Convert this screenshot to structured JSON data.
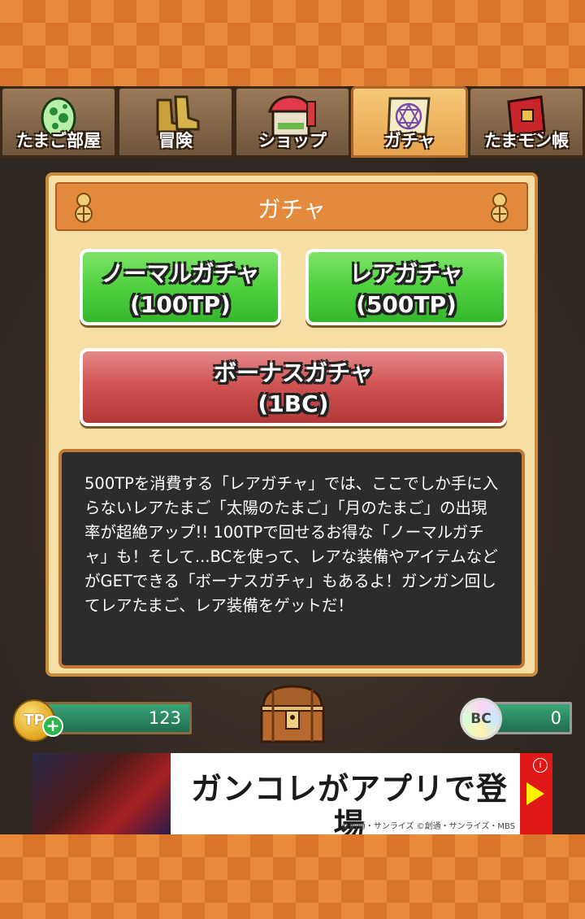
{
  "tabs": [
    {
      "label": "たまご部屋",
      "icon": "egg-icon",
      "active": false
    },
    {
      "label": "冒険",
      "icon": "boots-icon",
      "active": false
    },
    {
      "label": "ショップ",
      "icon": "shop-icon",
      "active": false
    },
    {
      "label": "ガチャ",
      "icon": "magic-scroll-icon",
      "active": true
    },
    {
      "label": "たまモン帳",
      "icon": "book-icon",
      "active": false
    }
  ],
  "panel": {
    "title": "ガチャ",
    "buttons": {
      "normal": {
        "line1": "ノーマルガチャ",
        "line2": "(100TP)"
      },
      "rare": {
        "line1": "レアガチャ",
        "line2": "(500TP)"
      },
      "bonus": {
        "line1": "ボーナスガチャ",
        "line2": "(1BC)"
      }
    },
    "description": "500TPを消費する「レアガチャ」では、ここでしか手に入らないレアたまご「太陽のたまご」「月のたまご」の出現率が超絶アップ!! 100TPで回せるお得な「ノーマルガチャ」も！そして...BCを使って、レアな装備やアイテムなどがGETできる「ボーナスガチャ」もあるよ！ガンガン回してレアたまご、レア装備をゲットだ！"
  },
  "currency": {
    "tp_label": "TP",
    "tp_value": "123",
    "tp_plus": "+",
    "bc_label": "BC",
    "bc_value": "0"
  },
  "banner": {
    "text": "ガンコレがアプリで登場",
    "copyright": "©創通・サンライズ ©創通・サンライズ・MBS",
    "info": "i"
  },
  "colors": {
    "accent_orange": "#e48a3c",
    "panel_bg": "#f5dfa5",
    "green_button": "#4ed03f",
    "red_button": "#d25555"
  }
}
